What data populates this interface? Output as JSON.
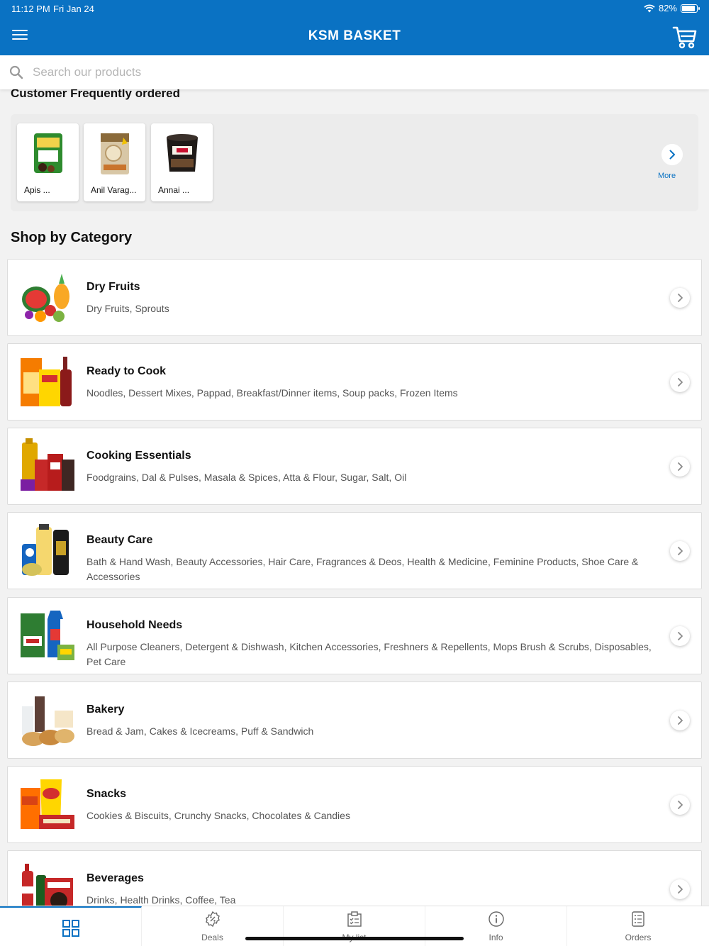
{
  "status_bar": {
    "time": "11:12 PM",
    "date": "Fri Jan 24",
    "battery": "82%",
    "battery_level": 0.82
  },
  "header": {
    "title": "KSM BASKET",
    "menu_icon": "hamburger-menu-icon",
    "cart_icon": "shopping-cart-icon",
    "brand_color": "#0a72c3"
  },
  "search": {
    "placeholder": "Search our products",
    "value": ""
  },
  "frequent": {
    "title": "Customer Frequently ordered",
    "items": [
      {
        "label": "Apis ..."
      },
      {
        "label": "Anil Varag..."
      },
      {
        "label": "Annai ..."
      }
    ],
    "more_label": "More"
  },
  "categories": {
    "title": "Shop by Category",
    "items": [
      {
        "name": "Dry Fruits",
        "desc": "Dry Fruits, Sprouts"
      },
      {
        "name": "Ready to Cook",
        "desc": "Noodles, Dessert Mixes, Pappad, Breakfast/Dinner items, Soup packs, Frozen Items"
      },
      {
        "name": "Cooking Essentials",
        "desc": "Foodgrains, Dal & Pulses, Masala & Spices, Atta & Flour, Sugar, Salt, Oil"
      },
      {
        "name": "Beauty Care",
        "desc": "Bath & Hand Wash, Beauty Accessories, Hair Care, Fragrances & Deos, Health & Medicine, Feminine Products, Shoe Care & Accessories"
      },
      {
        "name": "Household Needs",
        "desc": "All Purpose Cleaners, Detergent & Dishwash, Kitchen Accessories, Freshners & Repellents, Mops Brush & Scrubs, Disposables, Pet Care"
      },
      {
        "name": "Bakery",
        "desc": "Bread & Jam, Cakes & Icecreams, Puff & Sandwich"
      },
      {
        "name": "Snacks",
        "desc": "Cookies & Biscuits, Crunchy Snacks, Chocolates & Candies"
      },
      {
        "name": "Beverages",
        "desc": "Drinks, Health Drinks, Coffee, Tea"
      }
    ]
  },
  "tabs": [
    {
      "label": "",
      "icon": "grid-icon",
      "active": true
    },
    {
      "label": "Deals",
      "icon": "deals-badge-icon"
    },
    {
      "label": "My list",
      "icon": "checklist-icon"
    },
    {
      "label": "Info",
      "icon": "info-icon"
    },
    {
      "label": "Orders",
      "icon": "orders-list-icon"
    }
  ]
}
